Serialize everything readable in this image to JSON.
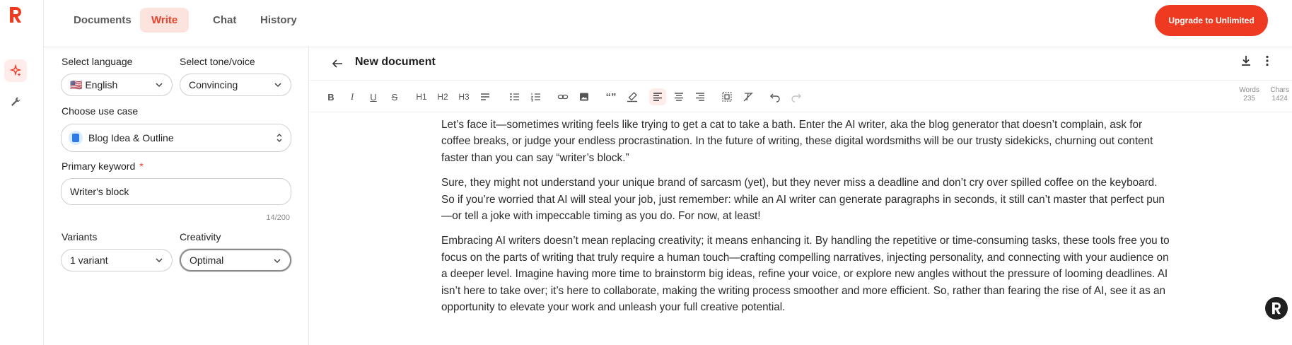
{
  "nav": {
    "tabs": [
      {
        "label": "Documents"
      },
      {
        "label": "Write"
      },
      {
        "label": "Chat"
      },
      {
        "label": "History"
      }
    ],
    "active_tab": "Write",
    "upgrade_label": "Upgrade to Unlimited"
  },
  "rail": {
    "items": [
      {
        "icon": "sparkles-icon"
      },
      {
        "icon": "wrench-icon"
      }
    ]
  },
  "panel": {
    "language_label": "Select language",
    "language_value": "🇺🇸 English",
    "tone_label": "Select tone/voice",
    "tone_value": "Convincing",
    "usecase_label": "Choose use case",
    "usecase_value": "Blog Idea & Outline",
    "keyword_label": "Primary keyword",
    "keyword_required": "*",
    "keyword_value": "Writer's block",
    "keyword_counter": "14/200",
    "variants_label": "Variants",
    "variants_value": "1 variant",
    "creativity_label": "Creativity",
    "creativity_value": "Optimal"
  },
  "editor": {
    "title": "New document",
    "toolbar": {
      "bold": "B",
      "italic": "I",
      "underline": "U",
      "strike": "S",
      "h1": "H1",
      "h2": "H2",
      "h3": "H3",
      "quote": "“”"
    },
    "stats": {
      "words_label": "Words",
      "words_value": "235",
      "chars_label": "Chars",
      "chars_value": "1424"
    },
    "paragraphs": [
      "Let’s face it—sometimes writing feels like trying to get a cat to take a bath. Enter the AI writer, aka the blog generator that doesn’t complain, ask for coffee breaks, or judge your endless procrastination. In the future of writing, these digital wordsmiths will be our trusty sidekicks, churning out content faster than you can say “writer’s block.”",
      "Sure, they might not understand your unique brand of sarcasm (yet), but they never miss a deadline and don’t cry over spilled coffee on the keyboard. So if you’re worried that AI will steal your job, just remember: while an AI writer can generate paragraphs in seconds, it still can’t master that perfect pun—or tell a joke with impeccable timing as you do. For now, at least!",
      "Embracing AI writers doesn’t mean replacing creativity; it means enhancing it. By handling the repetitive or time-consuming tasks, these tools free you to focus on the parts of writing that truly require a human touch—crafting compelling narratives, injecting personality, and connecting with your audience on a deeper level. Imagine having more time to brainstorm big ideas, refine your voice, or explore new angles without the pressure of looming deadlines. AI isn’t here to take over; it’s here to collaborate, making the writing process smoother and more efficient. So, rather than fearing the rise of AI, see it as an opportunity to elevate your work and unleash your full creative potential."
    ]
  },
  "colors": {
    "brand": "#ef3a22",
    "brand_tint": "#fde3de"
  }
}
